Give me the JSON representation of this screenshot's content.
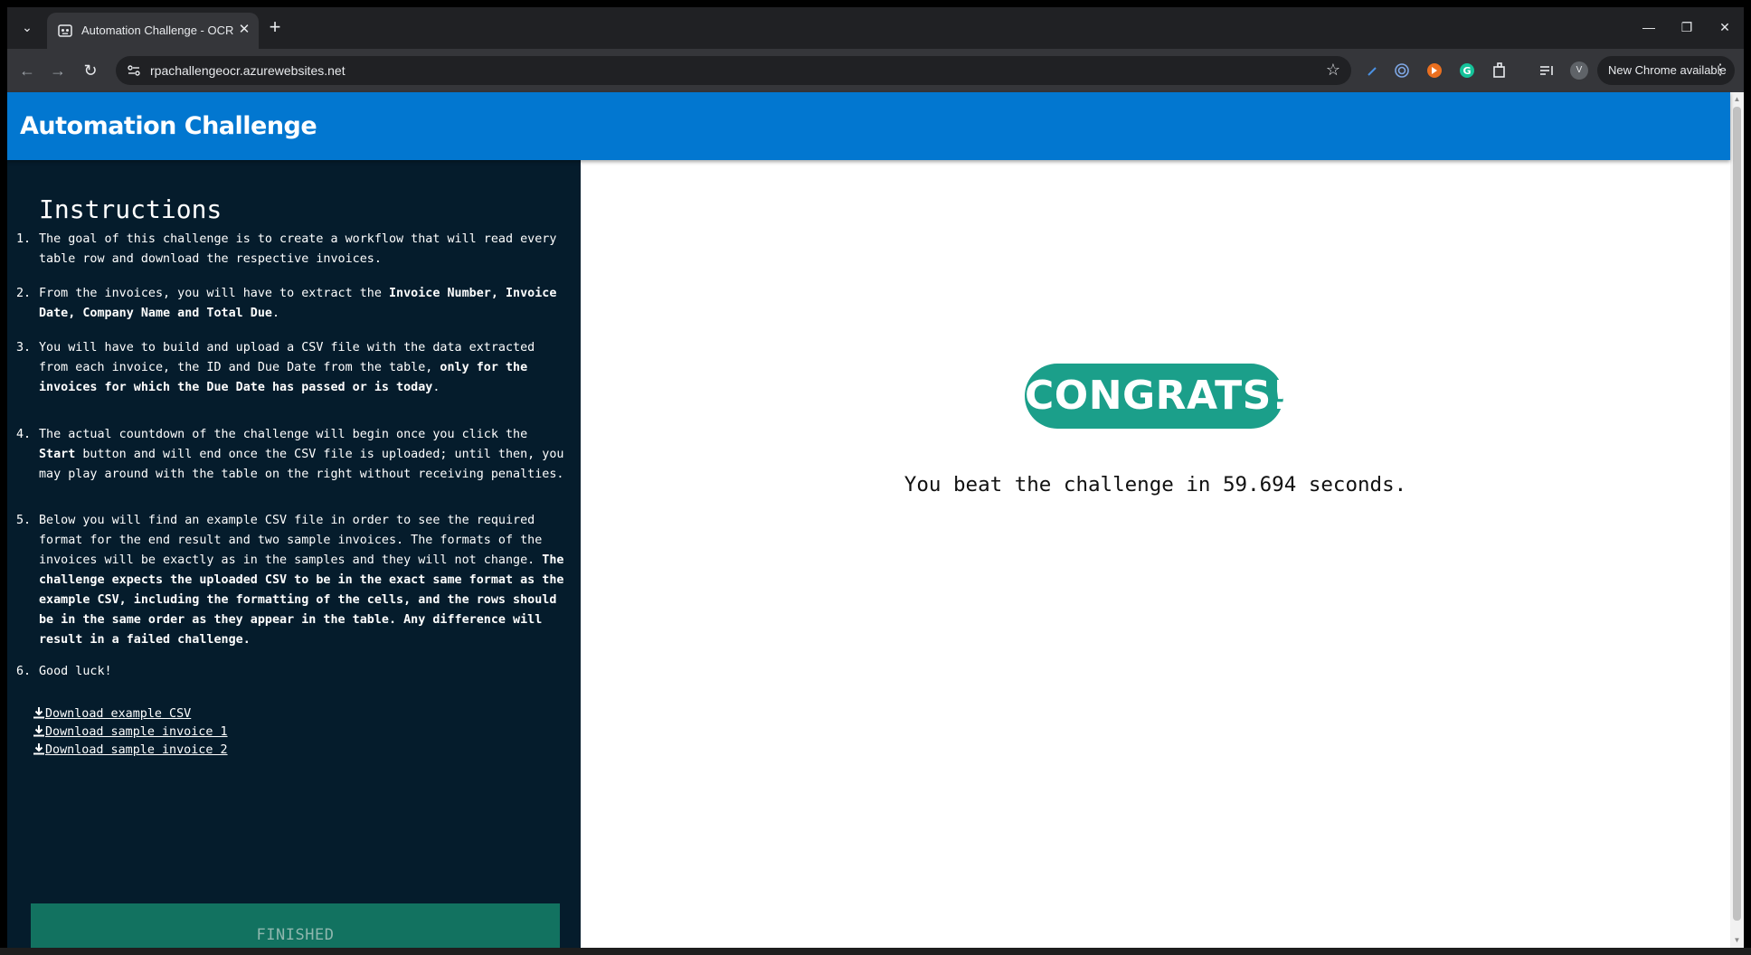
{
  "browser": {
    "tab_title": "Automation Challenge - OCR",
    "url": "rpachallengeocr.azurewebsites.net",
    "update_label": "New Chrome available",
    "profile_initial": "V"
  },
  "app": {
    "title": "Automation Challenge"
  },
  "instructions": {
    "title": "Instructions",
    "steps": [
      {
        "num": "1.",
        "html": "The goal of this challenge is to create a workflow that will read every table row and download the respective invoices."
      },
      {
        "num": "2.",
        "html": "From the invoices, you will have to extract the <b>Invoice Number, Invoice Date, Company Name and Total Due</b>."
      },
      {
        "num": "3.",
        "html": "You will have to build and upload a CSV file with the data extracted from each invoice, the ID and Due Date from the table, <b>only for the invoices for which the Due Date has passed or is today</b>."
      },
      {
        "num": "4.",
        "html": "The actual countdown of the challenge will begin once you click the <b>Start</b> button and will end once the CSV file is uploaded; until then, you may play around with the table on the right without receiving penalties."
      },
      {
        "num": "5.",
        "html": "Below you will find an example CSV file in order to see the required format for the end result and two sample invoices. The formats of the invoices will be exactly as in the samples and they will not change. <b>The challenge expects the uploaded CSV to be in the exact same format as the example CSV, including the formatting of the cells, and the rows should be in the same order as they appear in the table. Any difference will result in a failed challenge.</b>"
      },
      {
        "num": "6.",
        "html": "Good luck!"
      }
    ],
    "downloads": [
      "Download example CSV",
      "Download sample invoice 1",
      "Download sample invoice 2"
    ],
    "finished_label": "FINISHED"
  },
  "result": {
    "badge": "CONGRATS!",
    "message": "You beat the challenge in 59.694 seconds."
  },
  "colors": {
    "header": "#0277d0",
    "sidebar": "#051c2c",
    "badge": "#1b9f8a",
    "finished": "#127260"
  }
}
